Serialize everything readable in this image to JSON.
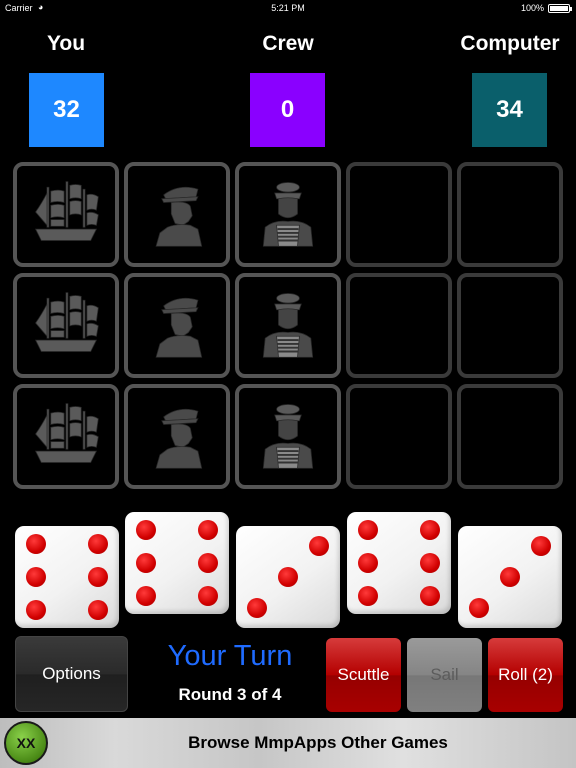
{
  "status_bar": {
    "carrier": "Carrier",
    "time": "5:21 PM",
    "battery": "100%"
  },
  "players": [
    {
      "label": "You",
      "score": "32",
      "color": "#1e88ff"
    },
    {
      "label": "Crew",
      "score": "0",
      "color": "#8a00ff"
    },
    {
      "label": "Computer",
      "score": "34",
      "color": "#0a5f6b"
    }
  ],
  "grid": {
    "rows": [
      [
        "ship-icon",
        "captain-icon",
        "sailor-icon",
        "empty",
        "empty"
      ],
      [
        "ship-icon",
        "captain-icon",
        "sailor-icon",
        "empty",
        "empty"
      ],
      [
        "ship-icon",
        "captain-icon",
        "sailor-icon",
        "empty",
        "empty"
      ]
    ]
  },
  "dice": [
    6,
    6,
    3,
    6,
    3
  ],
  "controls": {
    "options_label": "Options",
    "turn_label": "Your Turn",
    "round_label": "Round 3 of 4",
    "scuttle_label": "Scuttle",
    "sail_label": "Sail",
    "roll_label": "Roll (2)"
  },
  "banner": {
    "text": "Browse MmpApps Other Games",
    "logo_text": "XX"
  }
}
